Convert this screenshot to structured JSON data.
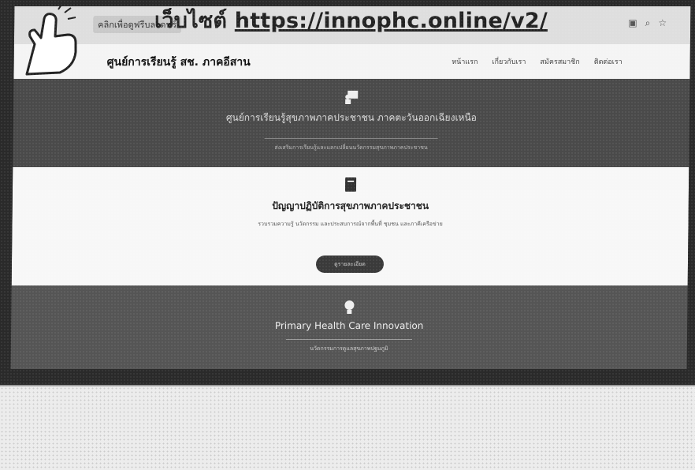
{
  "overlay": {
    "prefix": "เว็บไซต์",
    "url": "https://innophc.online/v2/"
  },
  "browser": {
    "address_label": "คลิกเพื่อดูฟรีบลวดฟร์",
    "icons": [
      "bookmark-icon",
      "search-icon",
      "star-icon"
    ]
  },
  "site": {
    "title": "ศูนย์การเรียนรู้ สช. ภาคอีสาน",
    "nav": [
      "หน้าแรก",
      "เกี่ยวกับเรา",
      "สมัครสมาชิก",
      "ติดต่อเรา"
    ]
  },
  "hero": {
    "title": "ศูนย์การเรียนรู้สุขภาพภาคประชาชน ภาคตะวันออกเฉียงเหนือ",
    "subtitle": "ส่งเสริมการเรียนรู้และแลกเปลี่ยนนวัตกรรมสุขภาพภาคประชาชน"
  },
  "middle": {
    "title": "ปัญญาปฏิบัติการสุขภาพภาคประชาชน",
    "subtitle": "รวบรวมความรู้ นวัตกรรม และประสบการณ์จากพื้นที่ ชุมชน และภาคีเครือข่าย",
    "button": "ดูรายละเอียด"
  },
  "lower": {
    "title": "Primary Health Care Innovation",
    "subtitle": "นวัตกรรมการดูแลสุขภาพปฐมภูมิ"
  },
  "colors": {
    "hero_bg": "#4a4a4a",
    "mid_bg": "#f7f7f7",
    "lower_bg": "#555555",
    "bezel": "#2a2a2a"
  }
}
